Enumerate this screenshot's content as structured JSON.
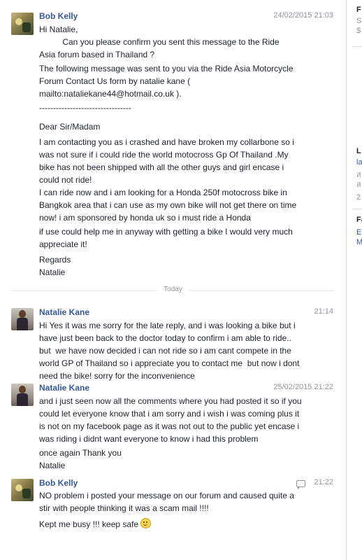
{
  "right_panel": {
    "items": [
      "F",
      "S",
      "$",
      "L",
      "la",
      "ส",
      "ส",
      "2",
      "Fa",
      "E",
      "M"
    ]
  },
  "messages": [
    {
      "sender": "Bob Kelly",
      "time": "24/02/2015 21:03",
      "paragraphs": [
        "Hi Natalie,\n          Can you please confirm you sent this message to the Ride\nAsia forum based in Thailand ?",
        "The following message was sent to you via the Ride Asia Motorcycle\nForum Contact Us form by natalie kane (\nmailto:nataliekane44@hotmail.co.uk ).",
        "---------------------------------",
        "Dear Sir/Madam",
        "I am contacting you as i crashed and have broken my collarbone so i\nwas not sure if i could ride the world motocross Gp Of Thailand .My\nbike has not been shipped with all the other guys and girl encase i\ncould not ride!",
        "I can ride now and i am looking for a Honda 250f motocross bike in\nBangkok area that i can use as my own bike will not get there on time\nnow! i am sponsored by honda uk so i must ride a Honda",
        "if use could help me in anyway with getting a bike I would very much\nappreciate it!",
        "Regards\nNatalie"
      ]
    },
    {
      "sender": "Natalie Kane",
      "time": "21:14",
      "paragraphs": [
        "Hi Yes it was me sorry for the late reply, and i was looking a bike but i\nhave just been back to the doctor today to confirm i am able to ride..\nbut  we have now decided i can not ride so i am cant compete in the\nworld GP of Thailand so i appreciate you to contact me  but now i dont\nneed the bike! sorry for the inconvenience"
      ]
    },
    {
      "sender": "Natalie Kane",
      "time": "25/02/2015 21:22",
      "paragraphs": [
        "and i just seen now all the comments where you had posted it so if you\ncould let everyone know that i am sorry and i wish i was coming plus it\nis not on my facebook page as it was not out to the public yet encase i\nwas riding i didnt want everyone to know i had this problem",
        "once again Thank you\nNatalie"
      ]
    },
    {
      "sender": "Bob Kelly",
      "time": "21:22",
      "paragraphs": [
        "NO problem i posted your message on our forum and caused quite a\nstir with people thinking it was a scam mail !!!!",
        "Kept me busy !!! keep safe"
      ]
    }
  ],
  "divider": "Today",
  "colors": {
    "name_link": "#365899",
    "timestamp": "#90949c",
    "text": "#1d2129"
  },
  "icons": [
    "reply-icon",
    "smiley-emoji-icon"
  ]
}
